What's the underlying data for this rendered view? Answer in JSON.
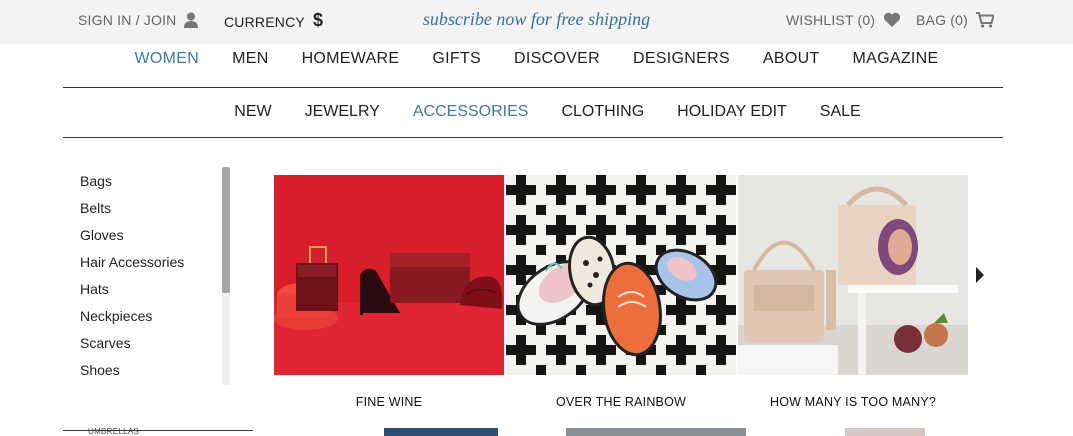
{
  "topbar": {
    "sign_in": "SIGN IN / JOIN",
    "currency": "CURRENCY",
    "promo": "subscribe now for free shipping",
    "wishlist": "WISHLIST (0)",
    "bag": "BAG (0)"
  },
  "main_nav": [
    "WOMEN",
    "MEN",
    "HOMEWARE",
    "GIFTS",
    "DISCOVER",
    "DESIGNERS",
    "ABOUT",
    "MAGAZINE"
  ],
  "main_nav_active": "WOMEN",
  "sub_nav": [
    "NEW",
    "JEWELRY",
    "ACCESSORIES",
    "CLOTHING",
    "HOLIDAY EDIT",
    "SALE"
  ],
  "sub_nav_active": "ACCESSORIES",
  "sidebar": {
    "items": [
      "Bags",
      "Belts",
      "Gloves",
      "Hair Accessories",
      "Hats",
      "Neckpieces",
      "Scarves",
      "Shoes"
    ],
    "partial_item": "UMBRELLAS"
  },
  "features": [
    {
      "caption": "FINE WINE"
    },
    {
      "caption": "OVER THE RAINBOW"
    },
    {
      "caption": "HOW MANY IS TOO MANY?"
    }
  ],
  "colors": {
    "accent": "#3d7aa8",
    "promo": "#3d6e99",
    "topbar_bg": "#f3f3f3"
  },
  "icons": {
    "account": "user-icon",
    "currency": "dollar-icon",
    "wishlist": "heart-icon",
    "bag": "cart-icon",
    "next": "chevron-right-icon"
  }
}
